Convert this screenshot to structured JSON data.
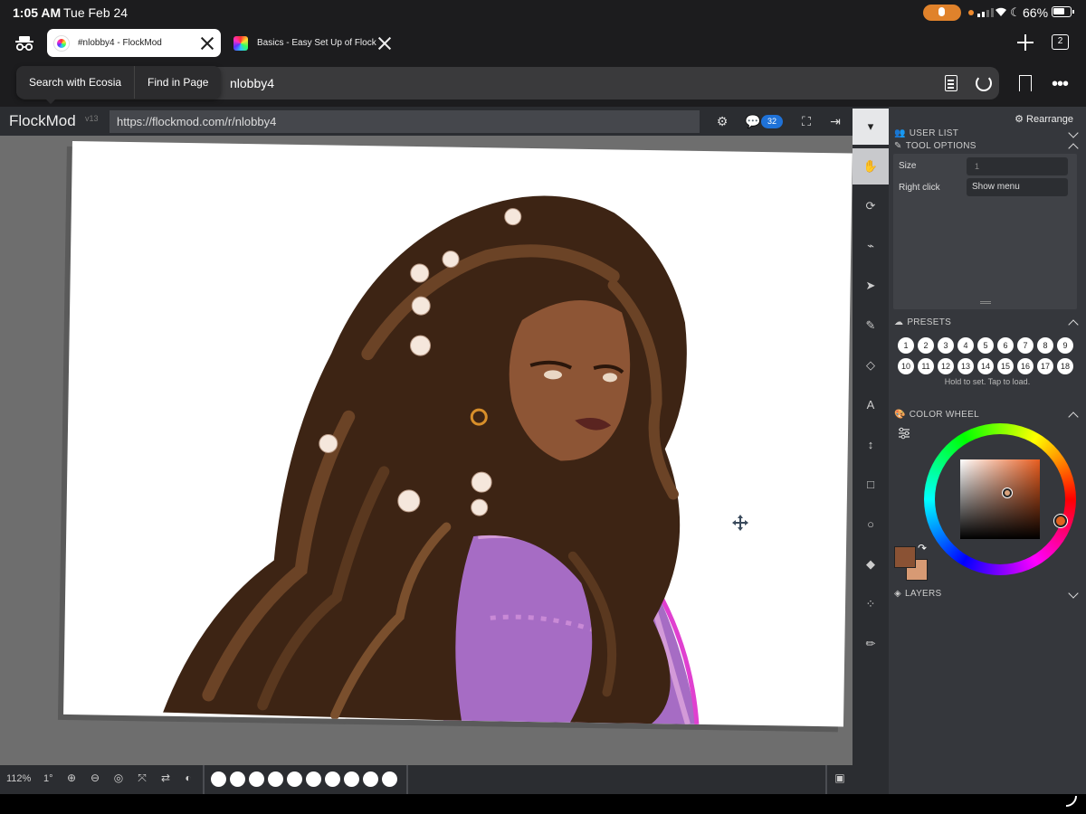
{
  "status_bar": {
    "time": "1:05 AM",
    "date": "Tue Feb 24",
    "battery": "66%"
  },
  "browser": {
    "tabs": [
      {
        "title": "#nlobby4 - FlockMod",
        "active": true
      },
      {
        "title": "Basics - Easy Set Up of Flockm",
        "active": false
      }
    ],
    "tab_count": "2",
    "address_fragment": "nlobby4",
    "context_menu": [
      "Search with Ecosia",
      "Find in Page"
    ]
  },
  "app": {
    "name": "FlockMod",
    "version": "v13",
    "room_url": "https://flockmod.com/r/nlobby4",
    "chat_count": "32",
    "zoom": "112%",
    "rotation": "1°",
    "brush_slots": 10
  },
  "panel": {
    "rearrange": "Rearrange",
    "sections": {
      "user_list": "USER LIST",
      "tool_options": "TOOL OPTIONS",
      "presets": "PRESETS",
      "color_wheel": "COLOR WHEEL",
      "layers": "LAYERS"
    },
    "tool_options": {
      "size_label": "Size",
      "size_value": "1",
      "right_click_label": "Right click",
      "right_click_value": "Show menu"
    },
    "presets": [
      "1",
      "2",
      "3",
      "4",
      "5",
      "6",
      "7",
      "8",
      "9",
      "10",
      "11",
      "12",
      "13",
      "14",
      "15",
      "16",
      "17",
      "18"
    ],
    "presets_hint": "Hold to set. Tap to load.",
    "colors": {
      "primary": "#8a5234",
      "secondary": "#d79a74"
    }
  },
  "tools": [
    "collapse-icon",
    "hand-icon",
    "rotate-icon",
    "eyedropper-icon",
    "select-icon",
    "brush-icon",
    "eraser-icon",
    "text-icon",
    "move-icon",
    "rectangle-icon",
    "ellipse-icon",
    "fill-icon",
    "lasso-icon",
    "pencil-icon"
  ]
}
